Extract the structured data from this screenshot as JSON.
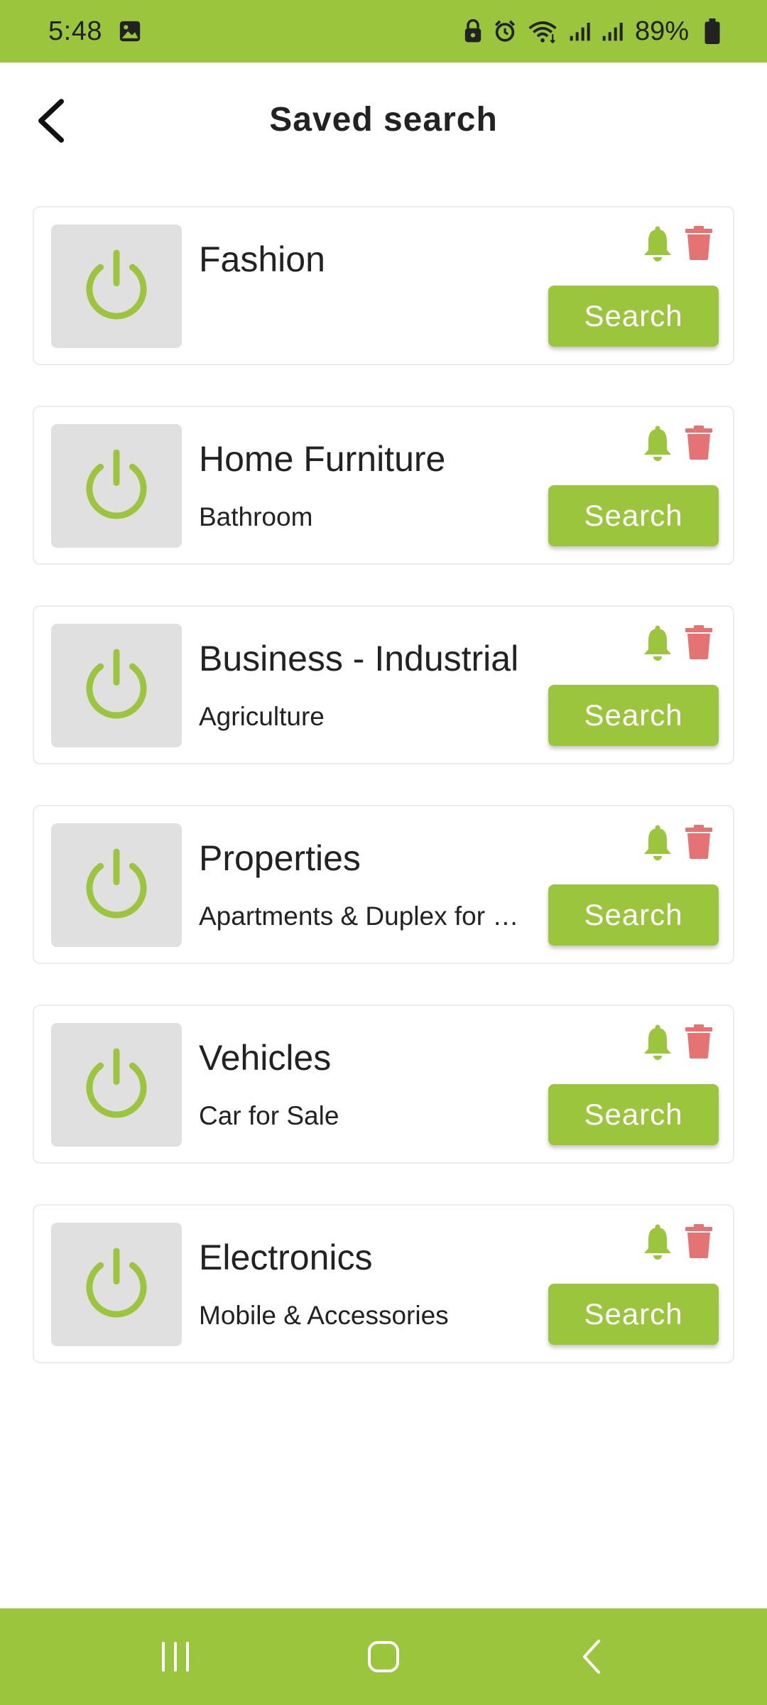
{
  "status_bar": {
    "time": "5:48",
    "battery_text": "89%",
    "icons": [
      "gallery-icon",
      "lock-icon",
      "alarm-icon",
      "wifi-icon",
      "signal-icon",
      "signal-icon",
      "battery-icon"
    ]
  },
  "header": {
    "title": "Saved search",
    "back_icon": "chevron-left-icon"
  },
  "saved_searches": [
    {
      "title": "Fashion",
      "subtitle": "",
      "button_label": "Search"
    },
    {
      "title": "Home Furniture",
      "subtitle": "Bathroom",
      "button_label": "Search"
    },
    {
      "title": "Business - Industrial",
      "subtitle": "Agriculture",
      "button_label": "Search"
    },
    {
      "title": "Properties",
      "subtitle": "Apartments & Duplex for Sale",
      "button_label": "Search"
    },
    {
      "title": "Vehicles",
      "subtitle": "Car for Sale",
      "button_label": "Search"
    },
    {
      "title": "Electronics",
      "subtitle": "Mobile & Accessories",
      "button_label": "Search"
    }
  ],
  "item_icons": {
    "thumbnail": "power-icon",
    "notify": "bell-icon",
    "delete": "trash-icon"
  },
  "colors": {
    "accent": "#9bc53d",
    "delete": "#e57373",
    "thumbnail_bg": "#e0e0e0"
  },
  "nav_bar": {
    "icons": [
      "recent-apps-icon",
      "home-icon",
      "back-icon"
    ]
  }
}
